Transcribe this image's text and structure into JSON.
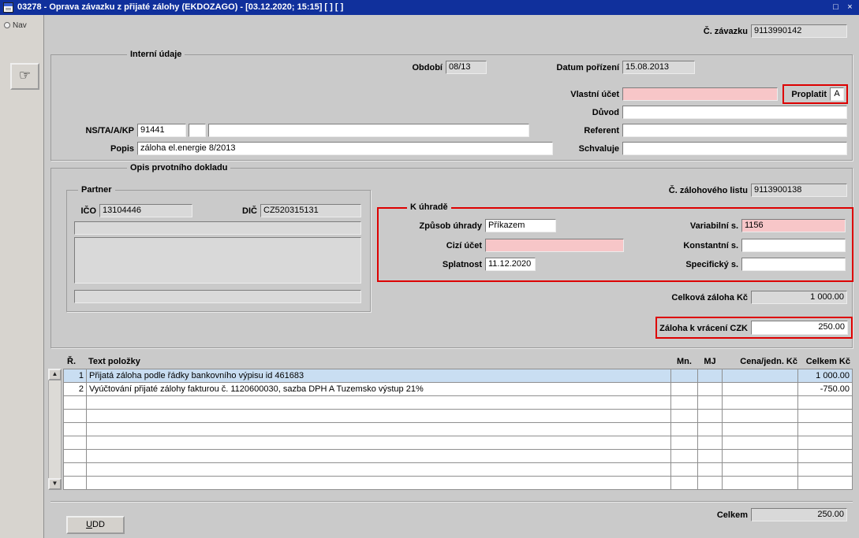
{
  "colors": {
    "titlebar": "#10309c",
    "form_bg": "#cacaca",
    "field_pink": "#f7c6c8",
    "field_gray": "#d9d9d9",
    "row_selected": "#c9def2",
    "highlight_red": "#dd0000"
  },
  "icons": {
    "hand_tool": "☞",
    "restore": "□",
    "close": "×",
    "scroll_up": "▲",
    "scroll_down": "▼"
  },
  "window": {
    "title": "03278 - Oprava závazku z přijaté zálohy (EKDOZAGO) - [03.12.2020; 15:15]  [ ] [ ]"
  },
  "nav": {
    "label": "Nav"
  },
  "header": {
    "zavazek_label": "Č. závazku",
    "zavazek_value": "9113990142"
  },
  "interni": {
    "frame": "Interní údaje",
    "obdobi_label": "Období",
    "obdobi_value": "08/13",
    "datum_label": "Datum pořízení",
    "datum_value": "15.08.2013",
    "vlastni_ucet_label": "Vlastní účet",
    "vlastni_ucet_value": "",
    "proplatit_label": "Proplatit",
    "proplatit_value": "A",
    "duvod_label": "Důvod",
    "duvod_value": "",
    "ns_label": "NS/TA/A/KP",
    "ns_value": "91441",
    "ns_value2": "",
    "ns_value3": "",
    "referent_label": "Referent",
    "referent_value": "",
    "popis_label": "Popis",
    "popis_value": "záloha el.energie 8/2013",
    "schvaluje_label": "Schvaluje",
    "schvaluje_value": ""
  },
  "opis": {
    "frame": "Opis prvotního dokladu",
    "partner": {
      "frame": "Partner",
      "ico_label": "IČO",
      "ico_value": "13104446",
      "dic_label": "DIČ",
      "dic_value": "CZ520315131",
      "name_value": "",
      "address_value": "",
      "extra_value": ""
    },
    "zal_list_label": "Č. zálohového listu",
    "zal_list_value": "9113900138",
    "k_uhrade": {
      "frame": "K úhradě",
      "zpusob_label": "Způsob úhrady",
      "zpusob_value": "Příkazem",
      "cizi_ucet_label": "Cizí účet",
      "cizi_ucet_value": "",
      "splatnost_label": "Splatnost",
      "splatnost_value": "11.12.2020",
      "variabilni_label": "Variabilní s.",
      "variabilni_value": "1156",
      "konstantni_label": "Konstantní s.",
      "konstantni_value": "",
      "specificky_label": "Specifický s.",
      "specificky_value": ""
    },
    "celkova_zaloha_label": "Celková záloha Kč",
    "celkova_zaloha_value": "1 000.00",
    "zaloha_vraceni_label": "Záloha k vrácení CZK",
    "zaloha_vraceni_value": "250.00"
  },
  "table": {
    "headers": {
      "r": "Ř.",
      "text": "Text položky",
      "mn": "Mn.",
      "mj": "MJ",
      "cena": "Cena/jedn. Kč",
      "celkem": "Celkem Kč"
    },
    "rows": [
      {
        "r": "1",
        "text": "Přijatá záloha podle řádky bankovního výpisu id 461683",
        "mn": "",
        "mj": "",
        "cena": "",
        "celkem": "1 000.00"
      },
      {
        "r": "2",
        "text": "Vyúčtování přijaté zálohy fakturou č. 1120600030, sazba DPH A  Tuzemsko výstup 21%",
        "mn": "",
        "mj": "",
        "cena": "",
        "celkem": "-750.00"
      },
      {
        "r": "",
        "text": "",
        "mn": "",
        "mj": "",
        "cena": "",
        "celkem": ""
      },
      {
        "r": "",
        "text": "",
        "mn": "",
        "mj": "",
        "cena": "",
        "celkem": ""
      },
      {
        "r": "",
        "text": "",
        "mn": "",
        "mj": "",
        "cena": "",
        "celkem": ""
      },
      {
        "r": "",
        "text": "",
        "mn": "",
        "mj": "",
        "cena": "",
        "celkem": ""
      },
      {
        "r": "",
        "text": "",
        "mn": "",
        "mj": "",
        "cena": "",
        "celkem": ""
      },
      {
        "r": "",
        "text": "",
        "mn": "",
        "mj": "",
        "cena": "",
        "celkem": ""
      },
      {
        "r": "",
        "text": "",
        "mn": "",
        "mj": "",
        "cena": "",
        "celkem": ""
      }
    ]
  },
  "footer": {
    "celkem_label": "Celkem",
    "celkem_value": "250.00",
    "udd_label": "UDD"
  }
}
